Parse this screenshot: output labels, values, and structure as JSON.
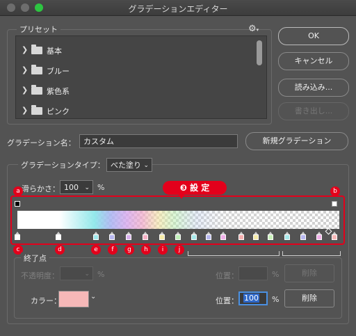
{
  "window": {
    "title": "グラデーションエディター"
  },
  "presets": {
    "legend": "プリセット",
    "items": [
      {
        "label": "基本"
      },
      {
        "label": "ブルー"
      },
      {
        "label": "紫色系"
      },
      {
        "label": "ピンク"
      }
    ]
  },
  "buttons": {
    "ok": "OK",
    "cancel": "キャンセル",
    "load": "読み込み...",
    "save": "書き出し...",
    "new_gradient": "新規グラデーション",
    "delete_opacity": "削除",
    "delete_color": "削除"
  },
  "name": {
    "label": "グラデーション名：",
    "value": "カスタム"
  },
  "gradient_type": {
    "label": "グラデーションタイプ：",
    "value": "べた塗り"
  },
  "smoothness": {
    "label": "滑らかさ：",
    "value": "100",
    "unit": "%"
  },
  "annotation": {
    "title": "❸ 設 定",
    "badges": [
      "a",
      "b",
      "c",
      "d",
      "e",
      "f",
      "g",
      "h",
      "i",
      "j"
    ]
  },
  "stops": {
    "legend": "終了点",
    "opacity_label": "不透明度：",
    "opacity_unit": "%",
    "location_label_1": "位置：",
    "location_unit_1": "%",
    "color_label": "カラー：",
    "color_value": "#f6b8b8",
    "location_label_2": "位置：",
    "location_value": "100",
    "location_unit_2": "%"
  }
}
